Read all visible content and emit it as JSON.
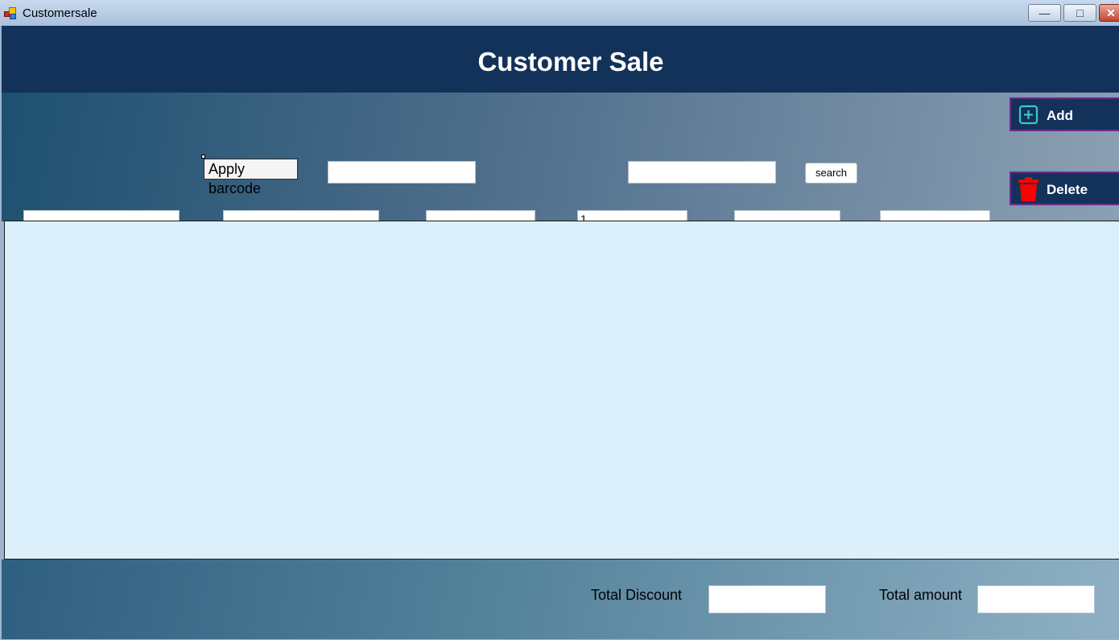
{
  "window": {
    "title": "Customersale"
  },
  "header": {
    "title": "Customer Sale"
  },
  "toolbar": {
    "apply_barcode_label": "Apply barcode",
    "barcode_value": "",
    "search_value": "",
    "search_label": "search"
  },
  "entry_row": {
    "field1": "",
    "field2": "",
    "field3": "",
    "quantity": "1",
    "field5": "",
    "field6": ""
  },
  "actions": {
    "add_label": "Add",
    "delete_label": "Delete"
  },
  "footer": {
    "total_discount_label": "Total Discount",
    "total_discount_value": "",
    "total_amount_label": "Total amount",
    "total_amount_value": ""
  },
  "colors": {
    "header_bg": "#12325a",
    "grid_bg": "#dcf0fb",
    "add_icon": "#3fc6c6",
    "delete_icon": "#ff0000",
    "button_border": "#6b2c8e"
  },
  "icons": {
    "app": "app-icon",
    "add": "add-square-icon",
    "delete": "trash-icon",
    "minimize": "minimize-icon",
    "maximize": "maximize-icon",
    "close": "close-icon"
  }
}
